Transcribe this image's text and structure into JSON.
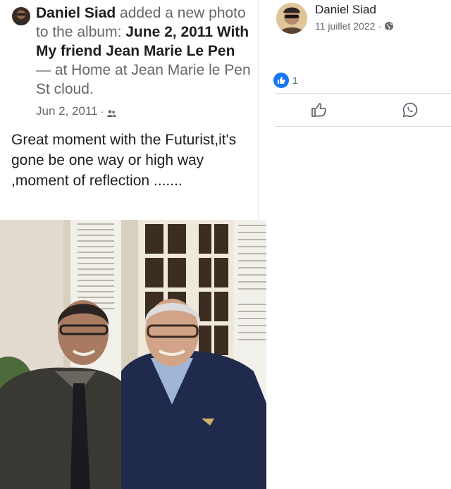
{
  "post": {
    "author": "Daniel Siad",
    "action_text": " added a new photo to the album: ",
    "album_title": "June 2, 2011 With My friend  Jean Marie Le Pen",
    "location_text": " — at Home at Jean Marie le Pen  St cloud.",
    "date": "Jun 2, 2011",
    "date_separator": " · ",
    "privacy_icon": "friends-icon",
    "body": "Great moment with the Futurist,it's gone be one way or high way ,moment of reflection ......."
  },
  "right_panel": {
    "author": "Daniel Siad",
    "date": "11 juillet 2022",
    "date_separator": " · ",
    "privacy_icon": "globe-icon",
    "reaction_icon": "like-icon",
    "reaction_count": "1",
    "actions": [
      {
        "icon": "thumbs-up-icon",
        "label": ""
      },
      {
        "icon": "whatsapp-icon",
        "label": ""
      }
    ]
  },
  "colors": {
    "facebook_blue": "#1877f2",
    "secondary_text": "#65676b",
    "primary_text": "#1c1e21",
    "divider": "#dadde1"
  }
}
